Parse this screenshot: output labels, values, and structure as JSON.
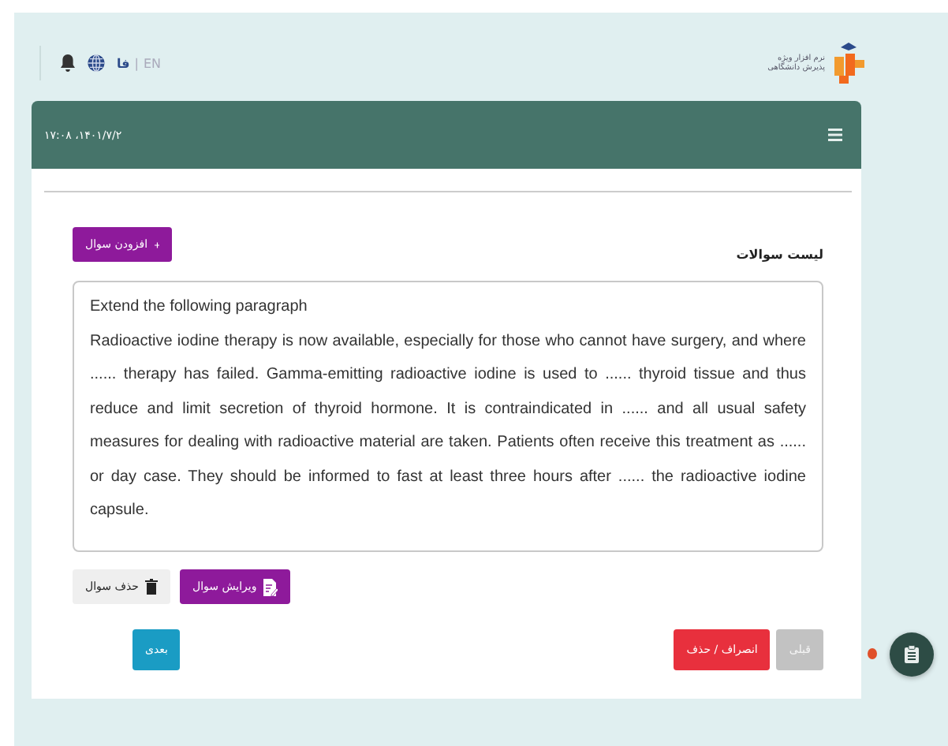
{
  "topbar": {
    "languages": [
      {
        "label": "EN",
        "selected": false
      },
      {
        "label": "فا",
        "selected": true
      }
    ],
    "separator": "|",
    "logo_lines": [
      "نرم افزار ویژه",
      "پذیرش دانشگاهی"
    ]
  },
  "header": {
    "datetime": "۱۷:۰۸ ،۱۴۰۱/۷/۲"
  },
  "add_button": "افزودن سوال",
  "list_title": "لیست سوالات",
  "question": {
    "title": "Extend the following paragraph",
    "body": "Radioactive iodine therapy is now available, especially for those who cannot have surgery, and where ...... therapy has failed. Gamma-emitting radioactive iodine is used to ...... thyroid tissue and thus reduce and limit secretion of thyroid hormone. It is contraindicated in ...... and all usual safety measures for dealing with radioactive material are taken. Patients often receive this treatment as ...... or day case. They should be informed to fast at least three hours after ...... the radioactive iodine capsule."
  },
  "question_actions": [
    {
      "kind": "edit",
      "label": "ویرایش سوال"
    },
    {
      "kind": "delete",
      "label": "حذف سوال"
    }
  ],
  "navigation": [
    {
      "kind": "previous",
      "label": "قبلی",
      "disabled": true
    },
    {
      "kind": "cancel",
      "label": "انصراف / حذف",
      "disabled": false
    },
    {
      "kind": "next",
      "label": "بعدی",
      "disabled": false
    }
  ],
  "floating": {
    "alert": true
  }
}
